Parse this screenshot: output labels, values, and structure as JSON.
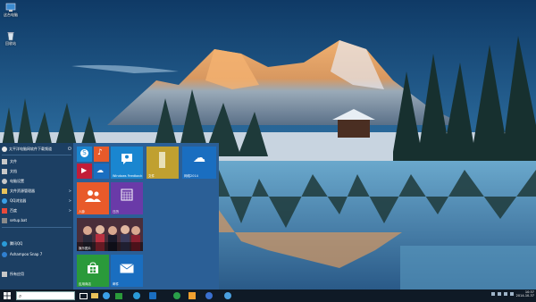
{
  "desktop": {
    "icons": [
      {
        "name": "computer-icon",
        "label": "这台电脑"
      },
      {
        "name": "recycle-bin-icon",
        "label": "回收站"
      }
    ]
  },
  "start_menu": {
    "user_name": "太平洋电脑网软件下载频道",
    "items": [
      {
        "name": "file-explorer",
        "label": "文件",
        "icon": "folder-icon",
        "color": "#c8c8c8",
        "arrow": ""
      },
      {
        "name": "docs",
        "label": "文档",
        "icon": "doc-icon",
        "color": "#c8c8c8",
        "arrow": ""
      },
      {
        "name": "settings",
        "label": "电脑设置",
        "icon": "gear-icon",
        "color": "#c8c8c8",
        "arrow": ""
      },
      {
        "name": "file-manager",
        "label": "文件资源管理器",
        "icon": "folder-icon",
        "color": "#e8c25a",
        "arrow": ">"
      },
      {
        "name": "qq-browser",
        "label": "QQ浏览器",
        "icon": "browser-icon",
        "color": "#3aa0e8",
        "arrow": ">"
      },
      {
        "name": "baidu",
        "label": "百度",
        "icon": "paw-icon",
        "color": "#e84a3a",
        "arrow": ">"
      },
      {
        "name": "setup",
        "label": "setup.bat",
        "icon": "file-icon",
        "color": "#8a8a8a",
        "arrow": ""
      },
      {
        "name": "tencent-qq",
        "label": "腾讯QQ",
        "icon": "penguin-icon",
        "color": "#2a9bd8",
        "arrow": ""
      },
      {
        "name": "ashampoo",
        "label": "Ashampoo Snap 7",
        "icon": "camera-icon",
        "color": "#3080d0",
        "arrow": ""
      },
      {
        "name": "all-apps",
        "label": "所有应用",
        "icon": "arrow-icon",
        "color": "#c8c8c8",
        "arrow": ""
      }
    ],
    "tiles": [
      {
        "name": "skype",
        "label": "",
        "color": "#1a86d0",
        "glyph": "S"
      },
      {
        "name": "music",
        "label": "",
        "color": "#e85a2a",
        "glyph": "♪"
      },
      {
        "name": "video",
        "label": "",
        "color": "#c21d38",
        "glyph": "▶"
      },
      {
        "name": "onedrive",
        "label": "",
        "color": "#1a6ec0",
        "glyph": "☁"
      },
      {
        "name": "windows-feedback",
        "label": "Windows Feedback",
        "color": "#1a86d0",
        "glyph": "👤"
      },
      {
        "name": "file-folder",
        "label": "文件",
        "color": "#c0a030",
        "glyph": "▮"
      },
      {
        "name": "network",
        "label": "网络2014",
        "color": "#1a6ec0",
        "glyph": "☁"
      },
      {
        "name": "people",
        "label": "人脉",
        "color": "#e85a2a",
        "glyph": "👥"
      },
      {
        "name": "calendar",
        "label": "日历",
        "color": "#6a3aa8",
        "glyph": "▦"
      },
      {
        "name": "news",
        "label": "娱乐图片",
        "color": "#5a3a4a",
        "glyph": ""
      },
      {
        "name": "store",
        "label": "应用商店",
        "color": "#2a9a3a",
        "glyph": "🛍"
      },
      {
        "name": "mail",
        "label": "邮件",
        "color": "#1a6ec0",
        "glyph": "✉"
      }
    ]
  },
  "taskbar": {
    "search_placeholder": "",
    "apps": [
      "start",
      "search",
      "task-view",
      "file-explorer",
      "ie",
      "store",
      "qq",
      "chrome",
      "app-u",
      "photoshop",
      "app-blue",
      "app-s"
    ],
    "clock_time": "10:37",
    "clock_date": "2014-10-37"
  },
  "colors": {
    "sky": "#1a4a78",
    "mountain": "#d8a86a",
    "lake": "#3a78a8"
  }
}
